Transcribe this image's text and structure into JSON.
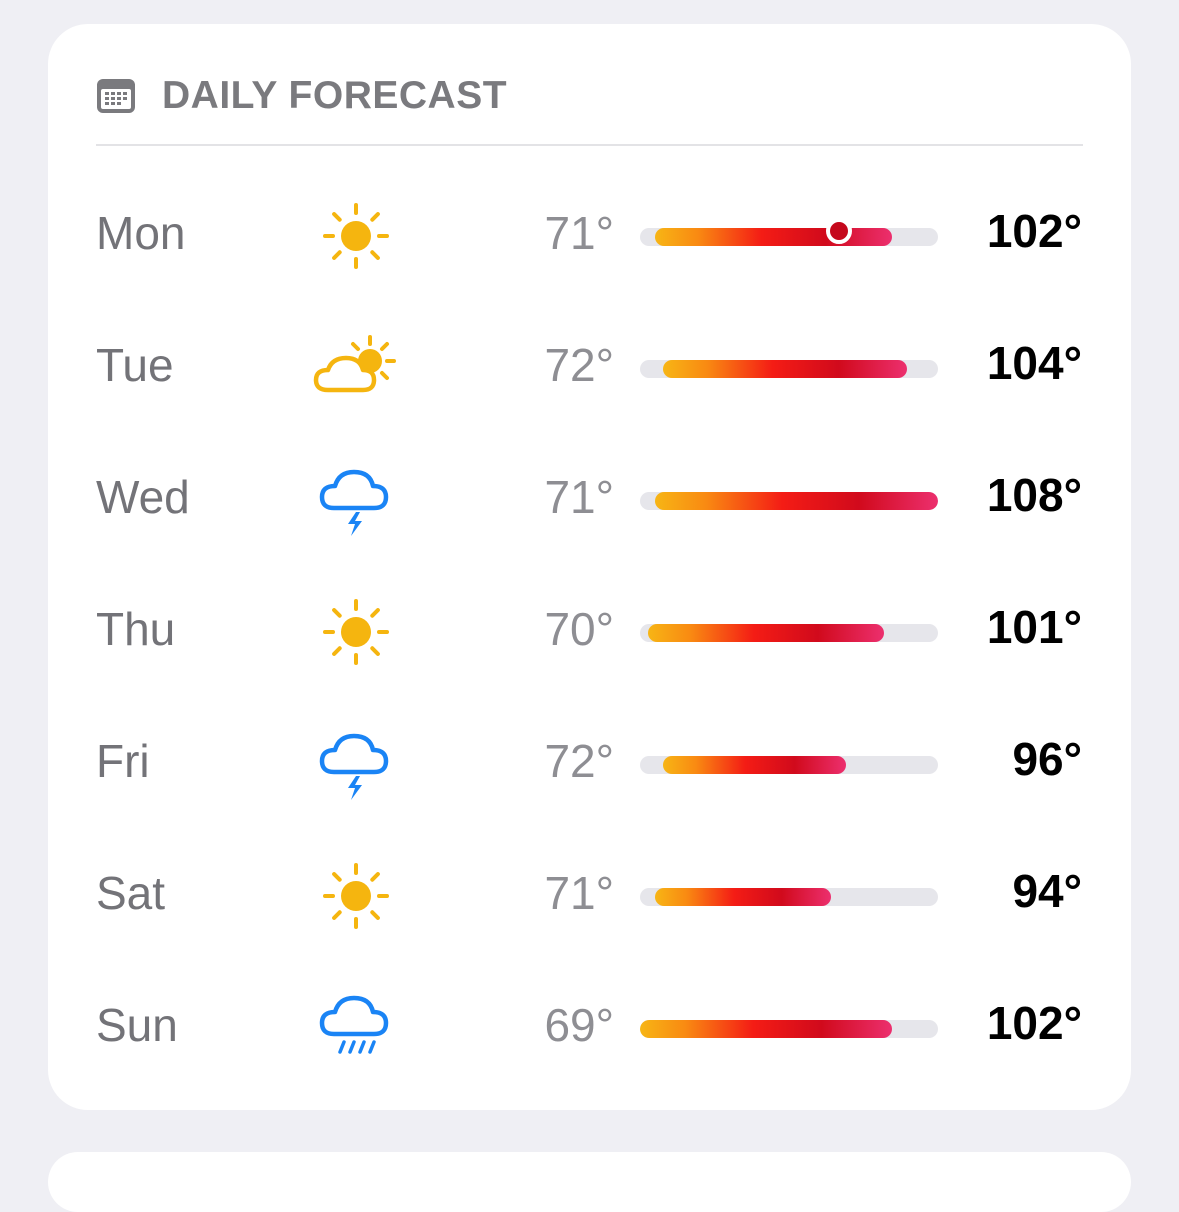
{
  "header": {
    "title": "DAILY FORECAST",
    "icon": "calendar-icon"
  },
  "scale": {
    "min": 69,
    "max": 108
  },
  "days": [
    {
      "day": "Mon",
      "icon": "sun-icon",
      "low": "71°",
      "high": "102°",
      "low_val": 71,
      "high_val": 102,
      "current_val": 95
    },
    {
      "day": "Tue",
      "icon": "partly-cloudy-icon",
      "low": "72°",
      "high": "104°",
      "low_val": 72,
      "high_val": 104
    },
    {
      "day": "Wed",
      "icon": "thunderstorm-icon",
      "low": "71°",
      "high": "108°",
      "low_val": 71,
      "high_val": 108
    },
    {
      "day": "Thu",
      "icon": "sun-icon",
      "low": "70°",
      "high": "101°",
      "low_val": 70,
      "high_val": 101
    },
    {
      "day": "Fri",
      "icon": "thunderstorm-icon",
      "low": "72°",
      "high": "96°",
      "low_val": 72,
      "high_val": 96
    },
    {
      "day": "Sat",
      "icon": "sun-icon",
      "low": "71°",
      "high": "94°",
      "low_val": 71,
      "high_val": 94
    },
    {
      "day": "Sun",
      "icon": "rain-icon",
      "low": "69°",
      "high": "102°",
      "low_val": 69,
      "high_val": 102
    }
  ],
  "colors": {
    "sun": "#f5b50f",
    "storm": "#1a84f5",
    "current_dot": "#c5081c"
  }
}
